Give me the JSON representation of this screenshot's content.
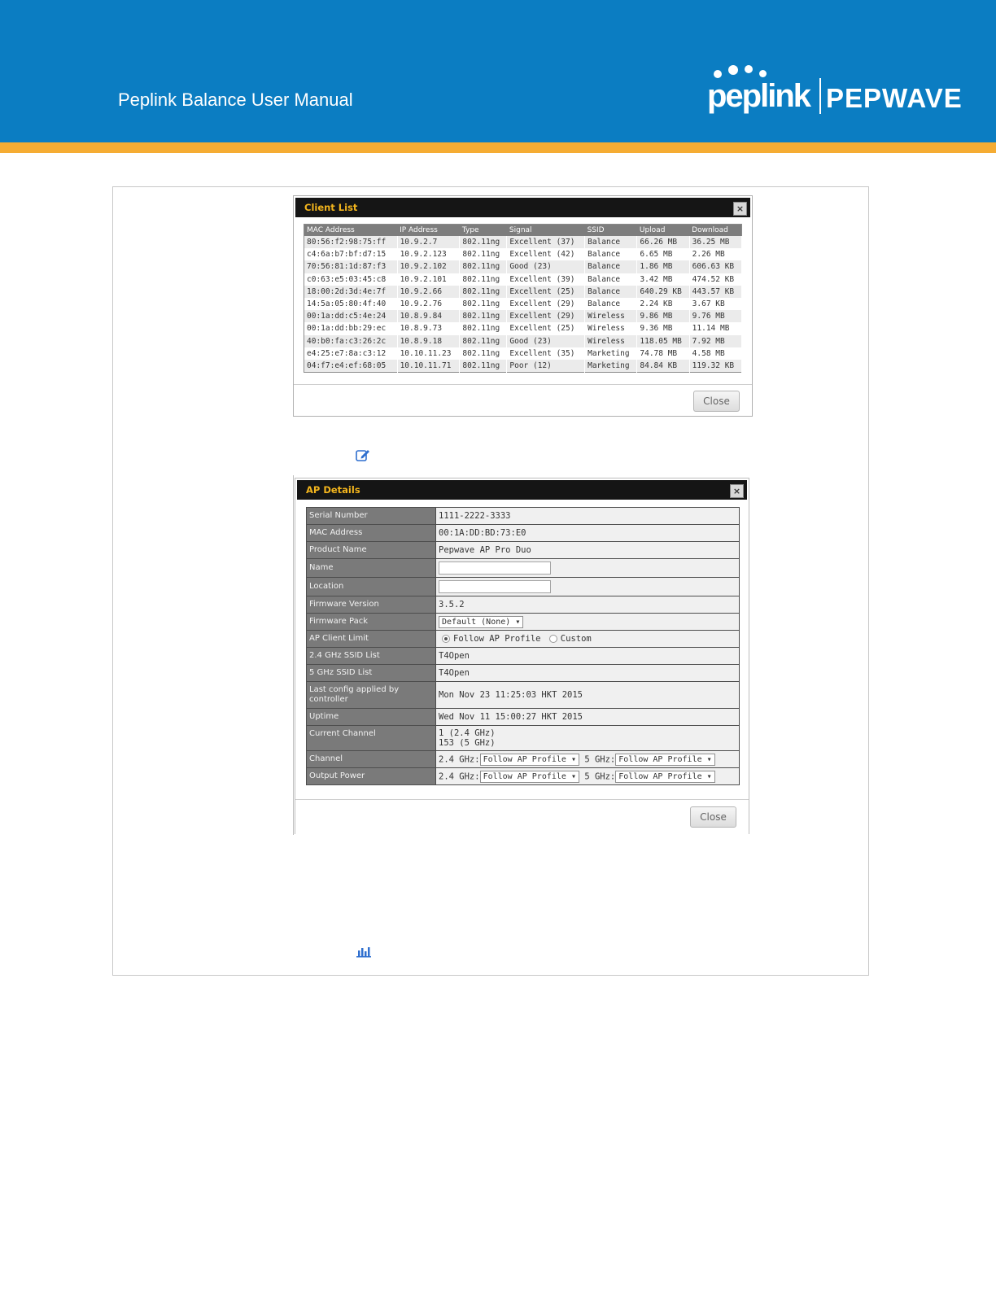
{
  "header": {
    "manual_title": "Peplink Balance User Manual",
    "logo_left": "peplink",
    "logo_right": "PEPWAVE",
    "colors": {
      "banner": "#0b7dc2",
      "stripe": "#f5ac33",
      "dialog_title": "#f3b51d"
    }
  },
  "client_list": {
    "title": "Client List",
    "close_label": "Close",
    "columns": [
      "MAC Address",
      "IP Address",
      "Type",
      "Signal",
      "SSID",
      "Upload",
      "Download"
    ],
    "rows": [
      [
        "80:56:f2:98:75:ff",
        "10.9.2.7",
        "802.11ng",
        "Excellent (37)",
        "Balance",
        "66.26 MB",
        "36.25 MB"
      ],
      [
        "c4:6a:b7:bf:d7:15",
        "10.9.2.123",
        "802.11ng",
        "Excellent (42)",
        "Balance",
        "6.65 MB",
        "2.26 MB"
      ],
      [
        "70:56:81:1d:87:f3",
        "10.9.2.102",
        "802.11ng",
        "Good (23)",
        "Balance",
        "1.86 MB",
        "606.63 KB"
      ],
      [
        "c0:63:e5:03:45:c8",
        "10.9.2.101",
        "802.11ng",
        "Excellent (39)",
        "Balance",
        "3.42 MB",
        "474.52 KB"
      ],
      [
        "18:00:2d:3d:4e:7f",
        "10.9.2.66",
        "802.11ng",
        "Excellent (25)",
        "Balance",
        "640.29 KB",
        "443.57 KB"
      ],
      [
        "14:5a:05:80:4f:40",
        "10.9.2.76",
        "802.11ng",
        "Excellent (29)",
        "Balance",
        "2.24 KB",
        "3.67 KB"
      ],
      [
        "00:1a:dd:c5:4e:24",
        "10.8.9.84",
        "802.11ng",
        "Excellent (29)",
        "Wireless",
        "9.86 MB",
        "9.76 MB"
      ],
      [
        "00:1a:dd:bb:29:ec",
        "10.8.9.73",
        "802.11ng",
        "Excellent (25)",
        "Wireless",
        "9.36 MB",
        "11.14 MB"
      ],
      [
        "40:b0:fa:c3:26:2c",
        "10.8.9.18",
        "802.11ng",
        "Good (23)",
        "Wireless",
        "118.05 MB",
        "7.92 MB"
      ],
      [
        "e4:25:e7:8a:c3:12",
        "10.10.11.23",
        "802.11ng",
        "Excellent (35)",
        "Marketing",
        "74.78 MB",
        "4.58 MB"
      ],
      [
        "04:f7:e4:ef:68:05",
        "10.10.11.71",
        "802.11ng",
        "Poor (12)",
        "Marketing",
        "84.84 KB",
        "119.32 KB"
      ]
    ]
  },
  "ap_details": {
    "title": "AP Details",
    "close_label": "Close",
    "serial_number": {
      "label": "Serial Number",
      "value": "1111-2222-3333"
    },
    "mac_address": {
      "label": "MAC Address",
      "value": "00:1A:DD:BD:73:E0"
    },
    "product_name": {
      "label": "Product Name",
      "value": "Pepwave AP Pro Duo"
    },
    "name": {
      "label": "Name",
      "value": ""
    },
    "location": {
      "label": "Location",
      "value": ""
    },
    "firmware_version": {
      "label": "Firmware Version",
      "value": "3.5.2"
    },
    "firmware_pack": {
      "label": "Firmware Pack",
      "value": "Default (None)"
    },
    "ap_client_limit": {
      "label": "AP Client Limit",
      "option_follow": "Follow AP Profile",
      "option_custom": "Custom",
      "selected": "Follow AP Profile"
    },
    "ssid_24": {
      "label": "2.4 GHz SSID List",
      "value": "T4Open"
    },
    "ssid_5": {
      "label": "5 GHz SSID List",
      "value": "T4Open"
    },
    "last_config": {
      "label": "Last config applied by controller",
      "value": "Mon Nov 23 11:25:03 HKT 2015"
    },
    "uptime": {
      "label": "Uptime",
      "value": "Wed Nov 11 15:00:27 HKT 2015"
    },
    "current_channel": {
      "label": "Current Channel",
      "line1": "1 (2.4 GHz)",
      "line2": "153 (5 GHz)"
    },
    "channel": {
      "label": "Channel",
      "band24_label": "2.4 GHz:",
      "band24_value": "Follow AP Profile",
      "band5_label": "5 GHz:",
      "band5_value": "Follow AP Profile"
    },
    "output_power": {
      "label": "Output Power",
      "band24_label": "2.4 GHz:",
      "band24_value": "Follow AP Profile",
      "band5_label": "5 GHz:",
      "band5_value": "Follow AP Profile"
    }
  }
}
